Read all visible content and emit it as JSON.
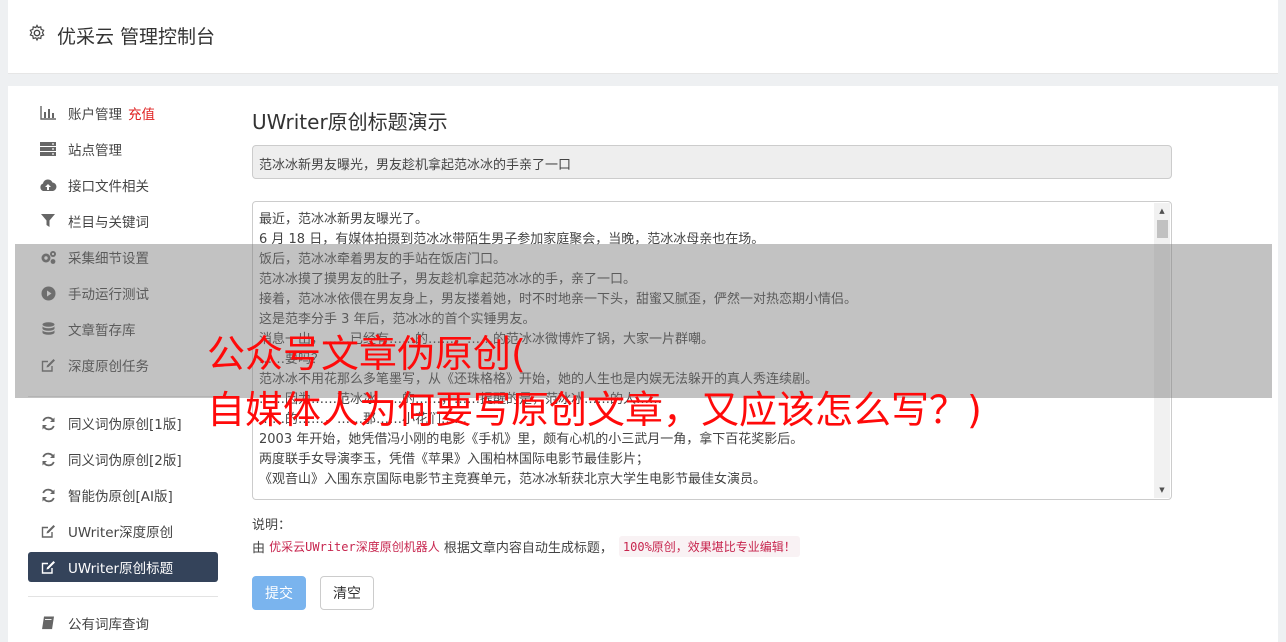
{
  "header": {
    "title": "优采云 管理控制台",
    "icon": "gear-icon"
  },
  "sidebar": {
    "items": [
      {
        "label": "账户管理",
        "badge": "充值",
        "icon": "bar-chart-icon"
      },
      {
        "label": "站点管理",
        "icon": "server-icon"
      },
      {
        "label": "接口文件相关",
        "icon": "cloud-upload-icon"
      },
      {
        "label": "栏目与关键词",
        "icon": "filter-icon"
      },
      {
        "label": "采集细节设置",
        "icon": "gears-icon"
      },
      {
        "label": "手动运行测试",
        "icon": "play-circle-icon"
      },
      {
        "label": "文章暂存库",
        "icon": "database-icon"
      },
      {
        "label": "深度原创任务",
        "icon": "edit-icon"
      },
      {
        "label": "同义词伪原创[1版]",
        "icon": "refresh-icon"
      },
      {
        "label": "同义词伪原创[2版]",
        "icon": "refresh-icon"
      },
      {
        "label": "智能伪原创[AI版]",
        "icon": "refresh-icon"
      },
      {
        "label": "UWriter深度原创",
        "icon": "edit-icon"
      },
      {
        "label": "UWriter原创标题",
        "icon": "edit-icon",
        "active": true
      },
      {
        "label": "公有词库查询",
        "icon": "book-icon"
      }
    ]
  },
  "main": {
    "page_title": "UWriter原创标题演示",
    "title_value": "范冰冰新男友曝光，男友趁机拿起范冰冰的手亲了一口",
    "article_lines": [
      "最近，范冰冰新男友曝光了。",
      "6 月 18 日，有媒体拍摄到范冰冰带陌生男子参加家庭聚会，当晚，范冰冰母亲也在场。",
      "饭后，范冰冰牵着男友的手站在饭店门口。",
      "范冰冰摸了摸男友的肚子，男友趁机拿起范冰冰的手，亲了一口。",
      "接着，范冰冰依偎在男友身上，男友搂着她，时不时地亲一下头，甜蜜又腻歪，俨然一对热恋期小情侣。",
      "这是范李分手 3 年后，范冰冰的首个实锤男友。",
      "消息一出，……已经有……的……，……的范冰冰微博炸了锅，大家一片群嘲。",
      "……要吗？",
      "范冰冰不用花那么多笔墨写，从《还珠格格》开始，她的人生也是内娱无法躲开的真人秀连续剧。",
      "……因为……范冰冰……的……，……提醒的是，范冰冰……的人……",
      "……的……，……那……小花们……",
      "2003 年开始，她凭借冯小刚的电影《手机》里，颇有心机的小三武月一角，拿下百花奖影后。",
      "两度联手女导演李玉，凭借《苹果》入围柏林国际电影节最佳影片；",
      "《观音山》入围东京国际电影节主竞赛单元，范冰冰斩获北京大学生电影节最佳女演员。"
    ],
    "note_label": "说明：",
    "note_prefix": "由",
    "note_robot": "优采云UWriter深度原创机器人",
    "note_middle": "根据文章内容自动生成标题，",
    "note_code": "100%原创，效果堪比专业编辑！",
    "submit_label": "提交",
    "clear_label": "清空"
  },
  "overlay": {
    "line1": "公众号文章伪原创(",
    "line2": "自媒体人为何要写原创文章，又应该怎么写？)"
  },
  "colors": {
    "accent": "#34435a",
    "badge": "#e02020",
    "overlay_text": "#ff0a0a",
    "submit": "#7ab4ee"
  }
}
